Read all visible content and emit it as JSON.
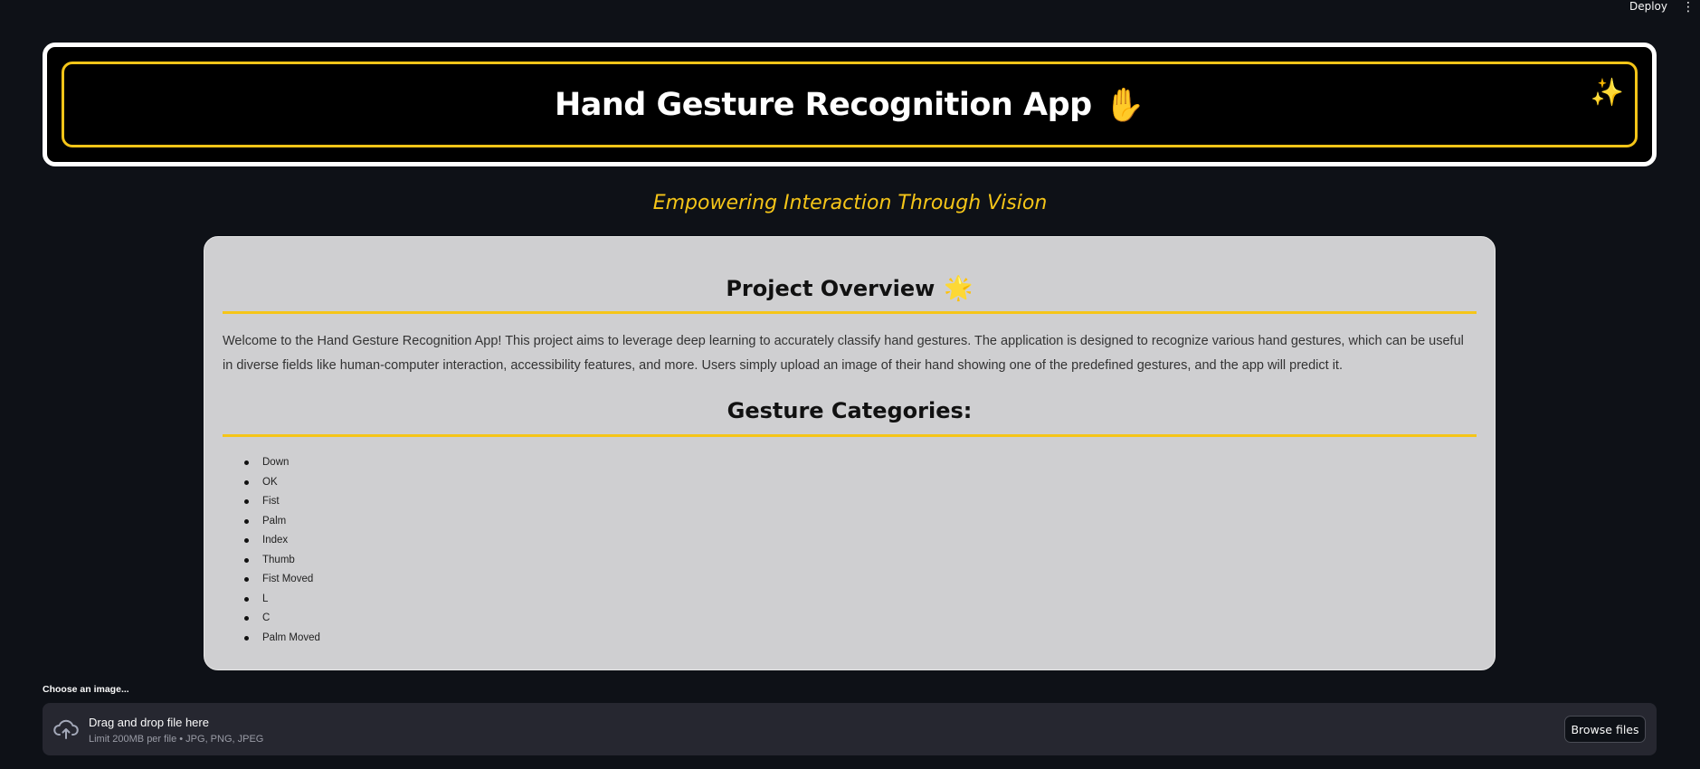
{
  "topbar": {
    "deploy_label": "Deploy",
    "menu_icon": "kebab-menu-icon"
  },
  "header": {
    "title": "Hand Gesture Recognition App",
    "hand_emoji": "✋",
    "sparkle_emoji": "✨"
  },
  "subtitle": "Empowering Interaction Through Vision",
  "overview": {
    "title": "Project Overview",
    "title_emoji": "🌟",
    "text": "Welcome to the Hand Gesture Recognition App! This project aims to leverage deep learning to accurately classify hand gestures. The application is designed to recognize various hand gestures, which can be useful in diverse fields like human-computer interaction, accessibility features, and more. Users simply upload an image of their hand showing one of the predefined gestures, and the app will predict it."
  },
  "categories": {
    "title": "Gesture Categories:",
    "items": [
      "Down",
      "OK",
      "Fist",
      "Palm",
      "Index",
      "Thumb",
      "Fist Moved",
      "L",
      "C",
      "Palm Moved"
    ]
  },
  "uploader": {
    "label": "Choose an image...",
    "drop_title": "Drag and drop file here",
    "limit": "Limit 200MB per file • JPG, PNG, JPEG",
    "browse_label": "Browse files"
  },
  "colors": {
    "accent": "#f5c518",
    "background": "#0e1117",
    "card": "#cfcfd1"
  }
}
